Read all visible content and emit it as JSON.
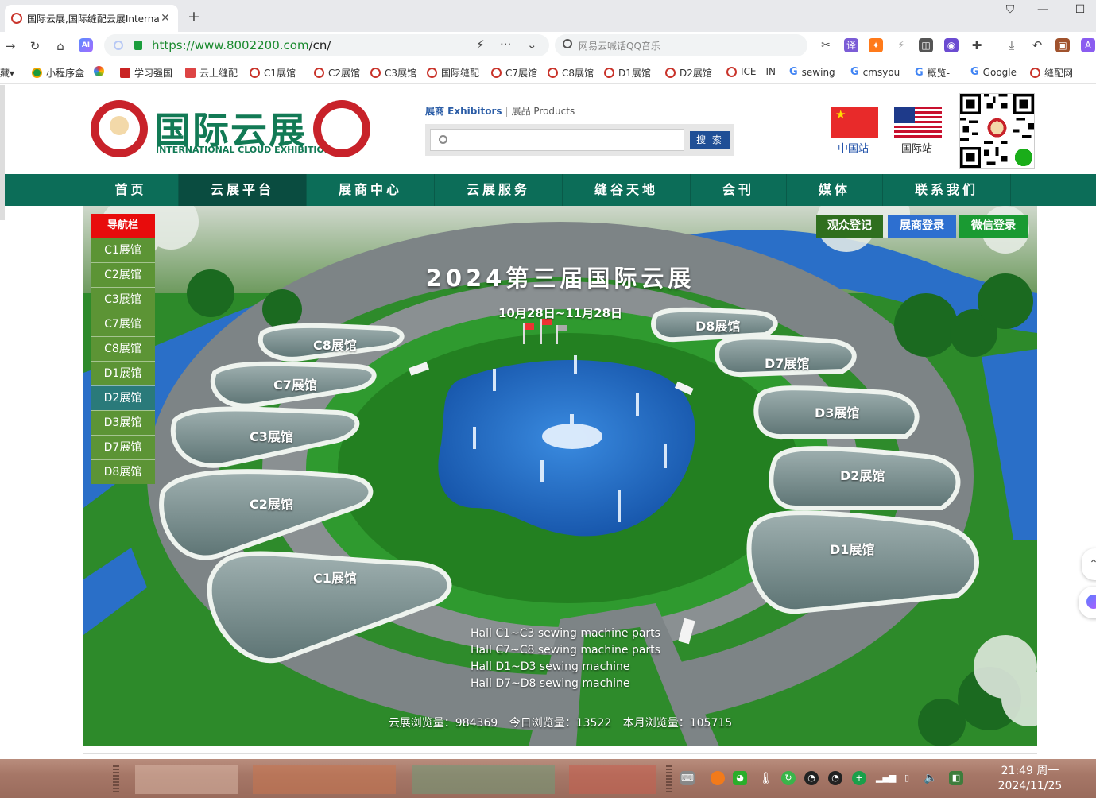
{
  "browser": {
    "tab_title": "国际云展,国际缝配云展Internat",
    "url_main": "https://www.8002200.com",
    "url_path": "/cn/",
    "search_placeholder": "网易云喊话QQ音乐",
    "bookmarks": [
      "藏",
      "小程序盒",
      "学习强国",
      "云上缝配",
      "C1展馆",
      "C2展馆",
      "C3展馆",
      "国际缝配",
      "C7展馆",
      "C8展馆",
      "D1展馆",
      "D2展馆",
      "ICE - IN",
      "sewing",
      "cmsyou",
      "概览",
      "Google",
      "缝配网"
    ]
  },
  "header": {
    "logo_cn": "国际云展",
    "logo_en": "INTERNATIONAL CLOUD EXHIBITION",
    "search_tab_exhibitors": "展商 Exhibitors",
    "search_tab_products": "展品 Products",
    "search_button": "搜 索",
    "site_cn": "中国站",
    "site_intl": "国际站"
  },
  "nav": [
    "首页",
    "云展平台",
    "展商中心",
    "云展服务",
    "缝谷天地",
    "会刊",
    "媒体",
    "联系我们"
  ],
  "nav_active_index": 1,
  "sidebar": {
    "title": "导航栏",
    "items": [
      "C1展馆",
      "C2展馆",
      "C3展馆",
      "C7展馆",
      "C8展馆",
      "D1展馆",
      "D2展馆",
      "D3展馆",
      "D7展馆",
      "D8展馆"
    ],
    "highlight_index": 6
  },
  "banner": {
    "title": "2024第三届国际云展",
    "date": "10月28日~11月28日",
    "buttons": [
      {
        "label": "观众登记",
        "color": "#2f6f1e"
      },
      {
        "label": "展商登录",
        "color": "#2d6fd0"
      },
      {
        "label": "微信登录",
        "color": "#1a9a32"
      }
    ],
    "halls": [
      "C8展馆",
      "C7展馆",
      "C3展馆",
      "C2展馆",
      "C1展馆",
      "D8展馆",
      "D7展馆",
      "D3展馆",
      "D2展馆",
      "D1展馆"
    ],
    "notes": [
      "Hall C1~C3 sewing machine parts",
      "Hall C7~C8 sewing machine parts",
      "Hall D1~D3 sewing machine",
      "Hall D7~D8 sewing machine"
    ],
    "stats": {
      "total": "云展浏览量：984369",
      "today": "今日浏览量：13522",
      "month": "本月浏览量：105715"
    }
  },
  "taskbar": {
    "time": "21:49 周一",
    "date": "2024/11/25"
  },
  "colors": {
    "brand_green": "#127a55",
    "nav_green": "#0c6d58",
    "side_red": "#e80c0c"
  }
}
